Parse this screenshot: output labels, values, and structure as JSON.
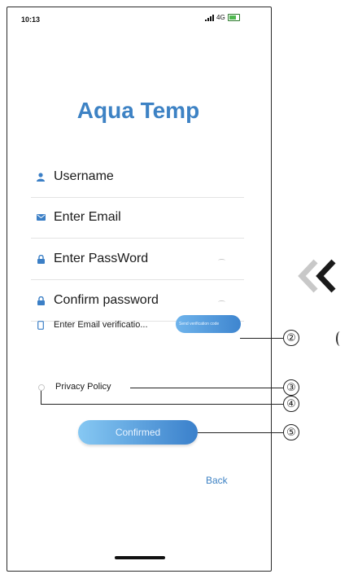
{
  "status_bar": {
    "time": "10:13",
    "network": "4G"
  },
  "app": {
    "title": "Aqua Temp"
  },
  "form": {
    "username_label": "Username",
    "email_label": "Enter Email",
    "password_label": "Enter PassWord",
    "confirm_password_label": "Confirm password",
    "verification_label": "Enter Email verificatio...",
    "send_code_button": "Send verification code",
    "privacy_label": "Privacy Policy",
    "confirm_button": "Confirmed",
    "back_link": "Back"
  },
  "callouts": [
    "②",
    "③",
    "④",
    "⑤"
  ],
  "icons": [
    "user-icon",
    "email-icon",
    "lock-icon",
    "lock-icon",
    "phone-icon",
    "eye-icon",
    "chevron-left-icon"
  ],
  "colors": {
    "accent": "#3d82c4",
    "button_start": "#86c8f3",
    "button_end": "#3a80cb"
  }
}
